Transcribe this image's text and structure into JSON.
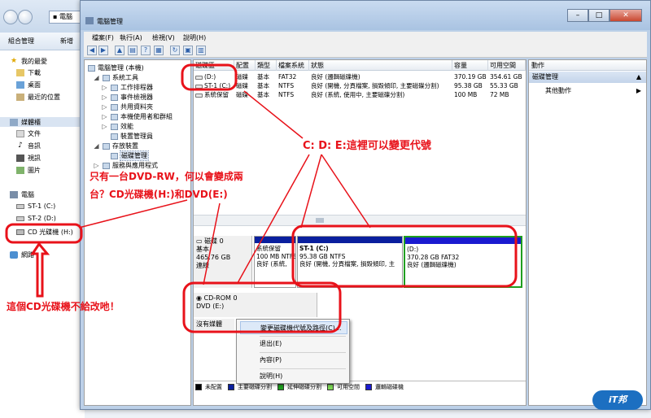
{
  "explorer": {
    "address": "電腦",
    "cmd": [
      "組合管理",
      "新增"
    ],
    "nav": {
      "favorites_header": "我的最愛",
      "favorites": [
        "下載",
        "桌面",
        "最近的位置"
      ],
      "libraries_header": "媒體櫃",
      "libraries": [
        "文件",
        "音訊",
        "視訊",
        "圖片"
      ],
      "computer_header": "電腦",
      "drives": [
        "ST-1 (C:)",
        "ST-2 (D:)",
        "CD 光碟機 (H:)"
      ],
      "network": "網路"
    }
  },
  "window": {
    "title": "電腦管理",
    "buttons": {
      "minimize": "–",
      "maximize": "□",
      "close": "✕"
    },
    "menu": [
      "檔案(F)",
      "執行(A)",
      "檢視(V)",
      "說明(H)"
    ]
  },
  "tree": {
    "root": "電腦管理 (本機)",
    "system_tools": "系統工具",
    "items": [
      "工作排程器",
      "事件檢視器",
      "共用資料夾",
      "本機使用者和群組",
      "效能",
      "裝置管理員"
    ],
    "storage": "存放裝置",
    "disk_mgmt": "磁碟管理",
    "services": "服務與應用程式"
  },
  "volumes": {
    "headers": [
      "磁碟區",
      "配置",
      "類型",
      "檔案系統",
      "狀態",
      "容量",
      "可用空間"
    ],
    "rows": [
      [
        "(D:)",
        "磁碟",
        "基本",
        "FAT32",
        "良好 (邏輯磁碟機)",
        "370.19 GB",
        "354.61 GB"
      ],
      [
        "ST-1 (C:)",
        "磁碟",
        "基本",
        "NTFS",
        "良好 (開機, 分頁檔案, 損毀傾印, 主要磁碟分割)",
        "95.38 GB",
        "55.33 GB"
      ],
      [
        "系統保留",
        "磁碟",
        "基本",
        "NTFS",
        "良好 (系統, 使用中, 主要磁碟分割)",
        "100 MB",
        "72 MB"
      ]
    ]
  },
  "disk0": {
    "name": "磁碟 0",
    "type": "基本",
    "size": "465.76 GB",
    "status": "連線",
    "partitions": [
      {
        "name": "系統保留",
        "size": "100 MB NTFS",
        "status": "良好 (系統,"
      },
      {
        "name": "ST-1 (C:)",
        "size": "95.38 GB NTFS",
        "status": "良好 (開機, 分頁檔案, 損毀傾印, 主"
      },
      {
        "name": "(D:)",
        "size": "370.28 GB FAT32",
        "status": "良好 (邏輯磁碟機)"
      }
    ]
  },
  "cdrom": {
    "name": "CD-ROM 0",
    "drive": "DVD (E:)",
    "media": "沒有媒體"
  },
  "context_menu": [
    "變更磁碟機代號及路徑(C)...",
    "退出(E)",
    "內容(P)",
    "說明(H)"
  ],
  "legend": [
    "未配置",
    "主要磁碟分割",
    "延伸磁碟分割",
    "可用空間",
    "邏輯磁碟機"
  ],
  "actions": {
    "header": "動作",
    "section": "磁碟管理",
    "more": "其他動作"
  },
  "annotations": {
    "change_letters": "C: D: E:這裡可以變更代號",
    "question_1": "只有一台DVD-RW，何以會變成兩",
    "question_2": "台？CD光碟機(H:)和DVD(E:)",
    "cannot_change": "這個CD光碟機不給改吔！"
  },
  "logo": "iT邦",
  "colors": {
    "annotation": "#e8121a",
    "primary": "#0a1f9e",
    "logical": "#1a1ad0",
    "extended": "#1f9e1f",
    "free": "#7ed957",
    "unallocated": "#000000"
  }
}
